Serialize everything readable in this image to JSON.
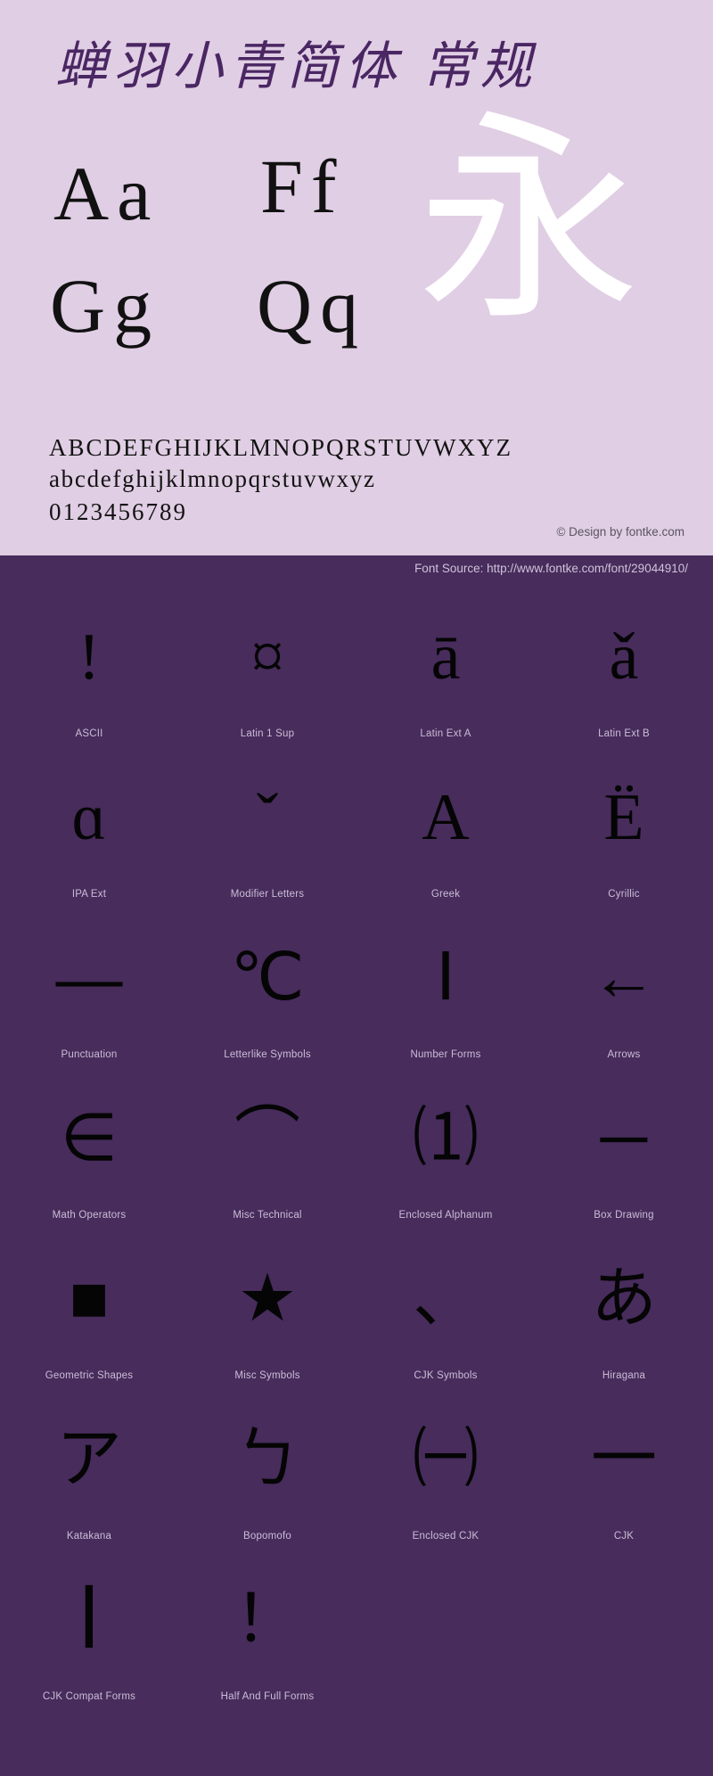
{
  "header": {
    "font_title": "蝉羽小青简体 常规",
    "background_color": "#e0cee4",
    "title_color": "#4a2663"
  },
  "showcase": {
    "pair_aa": "Aa",
    "pair_ff": "Ff",
    "pair_gg": "Gg",
    "pair_qq": "Qq",
    "cjk_sample": "永",
    "cjk_color": "#ffffff",
    "letters_color": "#111111"
  },
  "alphabet": {
    "uppercase": "ABCDEFGHIJKLMNOPQRSTUVWXYZ",
    "lowercase": "abcdefghijklmnopqrstuvwxyz",
    "digits": "0123456789"
  },
  "credits": {
    "copyright": "© Design by fontke.com",
    "source": "Font Source: http://www.fontke.com/font/29044910/"
  },
  "dark_panel": {
    "background_color": "#472c5c",
    "label_color": "#cbbdd6"
  },
  "unicode_blocks": {
    "rows": [
      [
        {
          "label": "ASCII",
          "glyph": "!",
          "heavy": false
        },
        {
          "label": "Latin 1 Sup",
          "glyph": "¤",
          "heavy": false
        },
        {
          "label": "Latin Ext A",
          "glyph": "ā",
          "heavy": false
        },
        {
          "label": "Latin Ext B",
          "glyph": "ǎ",
          "heavy": false
        }
      ],
      [
        {
          "label": "IPA Ext",
          "glyph": "ɑ",
          "heavy": false
        },
        {
          "label": "Modifier Letters",
          "glyph": "ˇ",
          "heavy": false
        },
        {
          "label": "Greek",
          "glyph": "Α",
          "heavy": false
        },
        {
          "label": "Cyrillic",
          "glyph": "Ё",
          "heavy": false
        }
      ],
      [
        {
          "label": "Punctuation",
          "glyph": "—",
          "heavy": true
        },
        {
          "label": "Letterlike Symbols",
          "glyph": "℃",
          "heavy": false
        },
        {
          "label": "Number Forms",
          "glyph": "Ⅰ",
          "heavy": false
        },
        {
          "label": "Arrows",
          "glyph": "←",
          "heavy": true
        }
      ],
      [
        {
          "label": "Math Operators",
          "glyph": "∈",
          "heavy": false
        },
        {
          "label": "Misc Technical",
          "glyph": "⌒",
          "heavy": false
        },
        {
          "label": "Enclosed Alphanum",
          "glyph": "⑴",
          "heavy": false
        },
        {
          "label": "Box Drawing",
          "glyph": "─",
          "heavy": true
        }
      ],
      [
        {
          "label": "Geometric Shapes",
          "glyph": "■",
          "heavy": false
        },
        {
          "label": "Misc Symbols",
          "glyph": "★",
          "heavy": false
        },
        {
          "label": "CJK Symbols",
          "glyph": "、",
          "heavy": false
        },
        {
          "label": "Hiragana",
          "glyph": "あ",
          "heavy": false
        }
      ],
      [
        {
          "label": "Katakana",
          "glyph": "ア",
          "heavy": false
        },
        {
          "label": "Bopomofo",
          "glyph": "ㄅ",
          "heavy": false
        },
        {
          "label": "Enclosed CJK",
          "glyph": "㈠",
          "heavy": false
        },
        {
          "label": "CJK",
          "glyph": "一",
          "heavy": false
        }
      ],
      [
        {
          "label": "CJK Compat Forms",
          "glyph": "丨",
          "heavy": true
        },
        {
          "label": "Half And Full Forms",
          "glyph": "！",
          "heavy": false
        },
        {
          "label": "",
          "glyph": "",
          "heavy": false,
          "empty": true
        },
        {
          "label": "",
          "glyph": "",
          "heavy": false,
          "empty": true
        }
      ]
    ]
  }
}
